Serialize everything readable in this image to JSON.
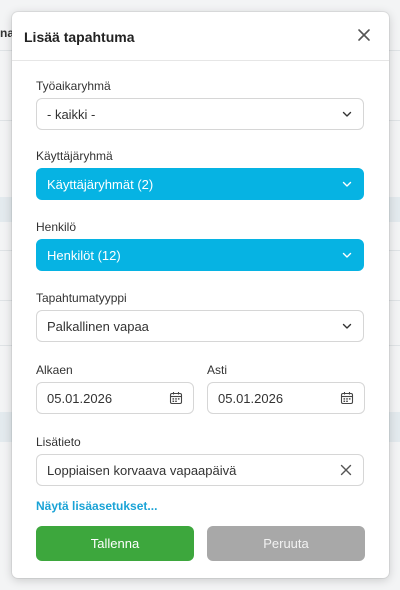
{
  "background": {
    "partial_heading": "na"
  },
  "dialog": {
    "title": "Lisää tapahtuma",
    "close_icon": "close-icon"
  },
  "fields": {
    "workgroup": {
      "label": "Työaikaryhmä",
      "value": "- kaikki -"
    },
    "usergroup": {
      "label": "Käyttäjäryhmä",
      "value": "Käyttäjäryhmät (2)"
    },
    "person": {
      "label": "Henkilö",
      "value": "Henkilöt (12)"
    },
    "event_type": {
      "label": "Tapahtumatyyppi",
      "value": "Palkallinen vapaa"
    },
    "start": {
      "label": "Alkaen",
      "value": "05.01.2026"
    },
    "end": {
      "label": "Asti",
      "value": "05.01.2026"
    },
    "info": {
      "label": "Lisätieto",
      "value": "Loppiaisen korvaava vapaapäivä"
    }
  },
  "more_settings_link": "Näytä lisäasetukset...",
  "buttons": {
    "save": "Tallenna",
    "cancel": "Peruuta"
  },
  "colors": {
    "accent_blue": "#06b3e3",
    "save_green": "#3da73d",
    "cancel_gray": "#a8a8a8",
    "link_blue": "#1aa3d6"
  }
}
